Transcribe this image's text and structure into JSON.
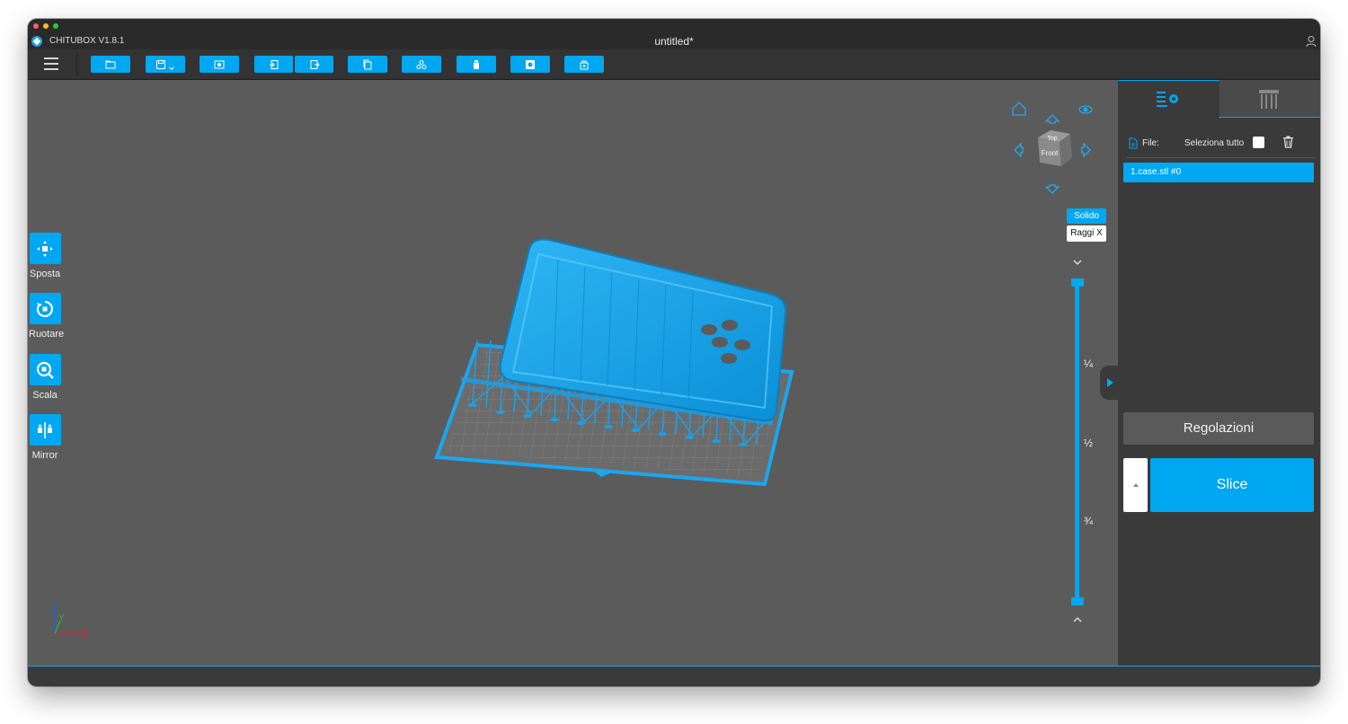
{
  "app": {
    "name": "CHITUBOX V1.8.1",
    "document_title": "untitled*"
  },
  "colors": {
    "accent": "#00a7f1",
    "viewport_bg": "#5b5b5b",
    "panel_bg": "#3a3a3a",
    "toolbar_bg": "#333333"
  },
  "toolbar": {
    "buttons": [
      {
        "name": "open-file-button",
        "icon": "folder-icon"
      },
      {
        "name": "save-button",
        "icon": "save-icon"
      },
      {
        "name": "screenshot-button",
        "icon": "screenshot-icon"
      },
      {
        "name": "import-button",
        "icon": "import-icon"
      },
      {
        "name": "export-button",
        "icon": "export-icon"
      },
      {
        "name": "copy-button",
        "icon": "copy-icon"
      },
      {
        "name": "arrange-button",
        "icon": "arrange-icon"
      },
      {
        "name": "hollow-button",
        "icon": "bottle-icon"
      },
      {
        "name": "drill-button",
        "icon": "hole-icon"
      },
      {
        "name": "support-button",
        "icon": "lock-icon"
      }
    ]
  },
  "left_tools": {
    "move": "Sposta",
    "rotate": "Ruotare",
    "scale": "Scala",
    "mirror": "Mirror"
  },
  "view": {
    "solid_label": "Solido",
    "xray_label": "Raggi X",
    "cube_top": "Top",
    "cube_front": "Front"
  },
  "layer_slider": {
    "markers": [
      "¼",
      "½",
      "¾"
    ]
  },
  "axes": {
    "x": "X",
    "y": "Y",
    "z": "Z"
  },
  "right_panel": {
    "file_label": "File:",
    "select_all_label": "Seleziona tutto",
    "files": [
      "1.case.stl #0"
    ],
    "adjust_label": "Regolazioni",
    "slice_label": "Slice"
  }
}
